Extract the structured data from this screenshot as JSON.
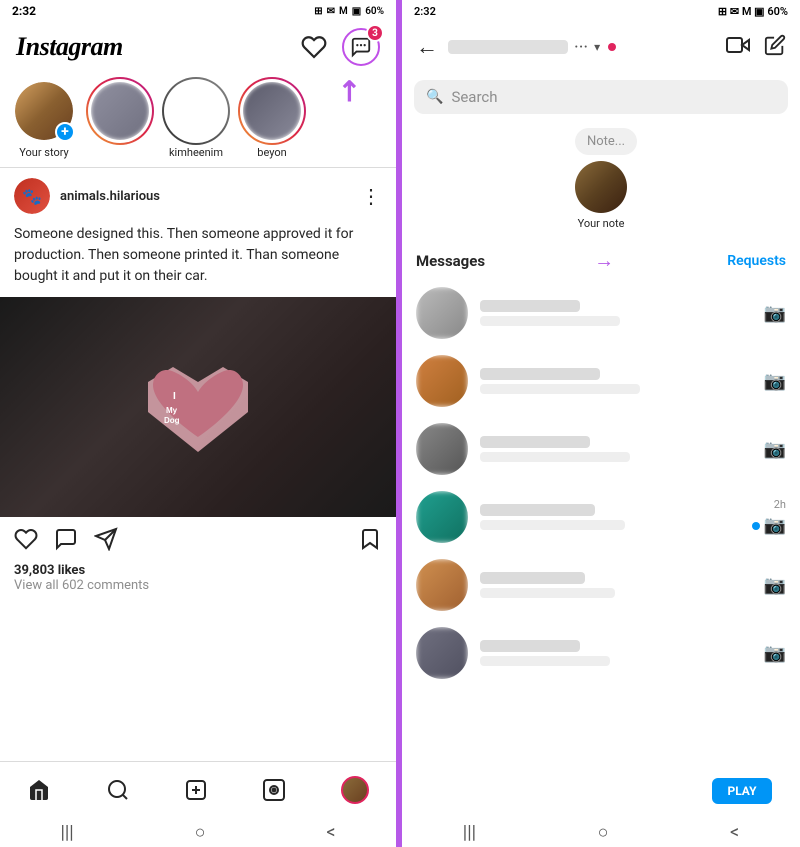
{
  "left": {
    "status_bar": {
      "time": "2:32",
      "icons": "⊞ ✉ M ▣ 📶 60%"
    },
    "header": {
      "logo": "Instagram",
      "heart_label": "♡",
      "messenger_label": "messenger",
      "badge_count": "3"
    },
    "stories": [
      {
        "label": "Your story",
        "type": "your"
      },
      {
        "label": "",
        "type": "blurred"
      },
      {
        "label": "kimheenim",
        "type": "bw"
      },
      {
        "label": "beyon",
        "type": "gradient"
      }
    ],
    "post": {
      "username": "animals.hilarious",
      "text": "Someone designed this. Then someone approved it for production. Then someone printed it. Than someone bought it and put it on their car.",
      "likes": "39,803 likes",
      "comments": "View all 602 comments"
    },
    "nav": {
      "home": "🏠",
      "search": "🔍",
      "add": "+",
      "reels": "▶",
      "profile": "👤"
    },
    "android_nav": {
      "menu": "|||",
      "home_circle": "○",
      "back": "<"
    }
  },
  "right": {
    "status_bar": {
      "time": "2:32",
      "icons": "⊞ ✉ M ▣ 📶 60%"
    },
    "header": {
      "back": "←",
      "video_call": "video-call",
      "edit": "edit"
    },
    "search": {
      "placeholder": "Search"
    },
    "note": {
      "bubble": "Note...",
      "label": "Your note"
    },
    "messages_section": {
      "title": "Messages",
      "requests": "Requests"
    },
    "message_items": [
      {
        "has_camera": true,
        "time": ""
      },
      {
        "has_camera": true,
        "time": ""
      },
      {
        "has_camera": true,
        "time": ""
      },
      {
        "has_camera": true,
        "time": "2h",
        "unread": true
      },
      {
        "has_camera": true,
        "time": ""
      },
      {
        "has_camera": true,
        "time": ""
      }
    ],
    "android_nav": {
      "menu": "|||",
      "home_circle": "○",
      "back": "<"
    }
  }
}
